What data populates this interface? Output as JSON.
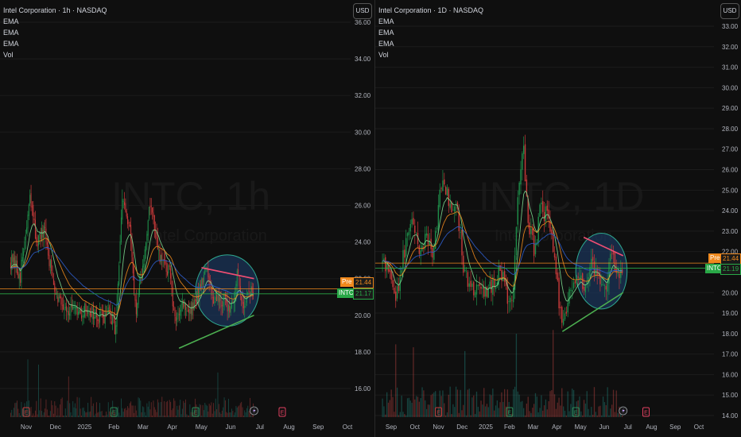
{
  "colors": {
    "background": "#0f0f0f",
    "up": "#26a69a",
    "down": "#ef5350",
    "up_candle": "#1e8f4a",
    "down_candle": "#c93a3a",
    "ema_fast": "#7bd88f",
    "ema_mid": "#f0891d",
    "ema_slow": "#2f5fd0",
    "pre_line": "#f0891d",
    "intc_line": "#29a847",
    "trend_upper": "#f04e73",
    "trend_lower": "#4caf50",
    "circle_fill": "#1b3458",
    "circle_stroke": "#2ea88f"
  },
  "charts": [
    {
      "key": "left",
      "legend": {
        "title": "Intel Corporation · 1h · NASDAQ",
        "ema1": "EMA",
        "ema2": "EMA",
        "ema3": "EMA",
        "vol": "Vol"
      },
      "currency": "USD",
      "watermark": {
        "main": "INTC, 1h",
        "sub": "Intel Corporation"
      },
      "price_tags": {
        "pre": {
          "label": "Pre",
          "value": "21.44"
        },
        "intc": {
          "label": "INTC",
          "value": "21.17"
        }
      },
      "event_icons": [
        "E",
        "E",
        "E",
        "E"
      ],
      "chart_data": {
        "type": "candlestick",
        "symbol": "INTC",
        "timeframe": "1h",
        "y_axis": {
          "ticks": [
            "16.00",
            "18.00",
            "20.00",
            "22.00",
            "24.00",
            "26.00",
            "28.00",
            "30.00",
            "32.00",
            "34.00",
            "36.00"
          ],
          "ylim": [
            14.5,
            36
          ]
        },
        "x_axis": {
          "ticks": [
            "Nov",
            "Dec",
            "2025",
            "Feb",
            "Mar",
            "Apr",
            "May",
            "Jun",
            "Jul",
            "Aug",
            "Sep",
            "Oct"
          ]
        },
        "price_path": [
          [
            "Oct 15",
            23.0
          ],
          [
            "Oct 25",
            22.2
          ],
          [
            "Nov 5",
            26.3
          ],
          [
            "Nov 12",
            24.0
          ],
          [
            "Nov 20",
            24.5
          ],
          [
            "Nov 28",
            22.0
          ],
          [
            "Dec 5",
            20.9
          ],
          [
            "Dec 15",
            20.3
          ],
          [
            "Dec 25",
            20.0
          ],
          [
            "Jan 5",
            20.4
          ],
          [
            "Jan 15",
            19.7
          ],
          [
            "Jan 25",
            20.2
          ],
          [
            "Feb 3",
            19.3
          ],
          [
            "Feb 10",
            26.4
          ],
          [
            "Feb 18",
            24.3
          ],
          [
            "Feb 24",
            20.0
          ],
          [
            "Mar 3",
            23.5
          ],
          [
            "Mar 8",
            26.2
          ],
          [
            "Mar 18",
            23.0
          ],
          [
            "Mar 28",
            22.5
          ],
          [
            "Apr 4",
            19.4
          ],
          [
            "Apr 10",
            20.8
          ],
          [
            "Apr 20",
            20.1
          ],
          [
            "Apr 28",
            21.3
          ],
          [
            "May 5",
            22.6
          ],
          [
            "May 12",
            21.1
          ],
          [
            "May 20",
            20.9
          ],
          [
            "May 28",
            20.4
          ],
          [
            "Jun 4",
            21.0
          ],
          [
            "Jun 8",
            22.1
          ],
          [
            "Jun 14",
            20.6
          ],
          [
            "Jun 20",
            21.3
          ],
          [
            "Jun 25",
            21.17
          ]
        ],
        "annotations": {
          "upper_trendline": [
            [
              "May 1",
              22.6
            ],
            [
              "Jun 25",
              22.0
            ]
          ],
          "lower_trendline": [
            [
              "Apr 8",
              18.2
            ],
            [
              "Jun 25",
              20.0
            ]
          ],
          "highlight_ellipse": {
            "from": "Apr 25",
            "to": "Jun 30",
            "price_from": 19.4,
            "price_to": 23.3
          }
        },
        "last_price": 21.17,
        "pre_market_price": 21.44
      }
    },
    {
      "key": "right",
      "legend": {
        "title": "Intel Corporation · 1D · NASDAQ",
        "ema1": "EMA",
        "ema2": "EMA",
        "ema3": "EMA",
        "vol": "Vol"
      },
      "currency": "USD",
      "watermark": {
        "main": "INTC, 1D",
        "sub": "Intel Corporation"
      },
      "price_tags": {
        "pre": {
          "label": "Pre",
          "value": "21.44"
        },
        "intc": {
          "label": "INTC",
          "value": "21.19"
        }
      },
      "event_icons": [
        "E",
        "E",
        "E",
        "E"
      ],
      "chart_data": {
        "type": "candlestick",
        "symbol": "INTC",
        "timeframe": "1D",
        "y_axis": {
          "ticks": [
            "14.00",
            "15.00",
            "16.00",
            "17.00",
            "18.00",
            "19.00",
            "20.00",
            "21.00",
            "22.00",
            "23.00",
            "24.00",
            "25.00",
            "26.00",
            "27.00",
            "28.00",
            "29.00",
            "30.00",
            "31.00",
            "32.00",
            "33.00"
          ],
          "ylim": [
            13.8,
            33.3
          ]
        },
        "x_axis": {
          "ticks": [
            "Sep",
            "Oct",
            "Nov",
            "Dec",
            "2025",
            "Feb",
            "Mar",
            "Apr",
            "May",
            "Jun",
            "Jul",
            "Aug",
            "Sep",
            "Oct"
          ]
        },
        "price_path": [
          [
            "Aug 20",
            21.5
          ],
          [
            "Sep 1",
            21.0
          ],
          [
            "Sep 6",
            19.5
          ],
          [
            "Sep 15",
            21.5
          ],
          [
            "Sep 25",
            23.5
          ],
          [
            "Oct 5",
            22.2
          ],
          [
            "Oct 15",
            22.6
          ],
          [
            "Oct 25",
            22.0
          ],
          [
            "Nov 1",
            24.3
          ],
          [
            "Nov 8",
            25.6
          ],
          [
            "Nov 15",
            24.2
          ],
          [
            "Nov 25",
            24.0
          ],
          [
            "Dec 3",
            21.2
          ],
          [
            "Dec 10",
            20.5
          ],
          [
            "Dec 20",
            20.0
          ],
          [
            "Dec 30",
            19.9
          ],
          [
            "Jan 10",
            20.3
          ],
          [
            "Jan 20",
            21.1
          ],
          [
            "Jan 31",
            19.4
          ],
          [
            "Feb 5",
            19.7
          ],
          [
            "Feb 11",
            24.2
          ],
          [
            "Feb 18",
            27.4
          ],
          [
            "Feb 24",
            23.7
          ],
          [
            "Mar 3",
            22.0
          ],
          [
            "Mar 10",
            24.0
          ],
          [
            "Mar 18",
            23.8
          ],
          [
            "Mar 28",
            22.0
          ],
          [
            "Apr 4",
            19.4
          ],
          [
            "Apr 8",
            18.2
          ],
          [
            "Apr 15",
            19.8
          ],
          [
            "Apr 25",
            20.6
          ],
          [
            "May 5",
            20.3
          ],
          [
            "May 15",
            21.4
          ],
          [
            "May 25",
            20.4
          ],
          [
            "Jun 3",
            20.0
          ],
          [
            "Jun 10",
            22.4
          ],
          [
            "Jun 17",
            20.8
          ],
          [
            "Jun 25",
            21.19
          ]
        ],
        "annotations": {
          "upper_trendline": [
            [
              "May 5",
              22.7
            ],
            [
              "Jun 25",
              21.8
            ]
          ],
          "lower_trendline": [
            [
              "Apr 8",
              18.1
            ],
            [
              "Jun 25",
              20.0
            ]
          ],
          "highlight_ellipse": {
            "from": "Apr 25",
            "to": "Jun 30",
            "price_from": 19.2,
            "price_to": 22.9
          }
        },
        "last_price": 21.19,
        "pre_market_price": 21.44
      }
    }
  ]
}
